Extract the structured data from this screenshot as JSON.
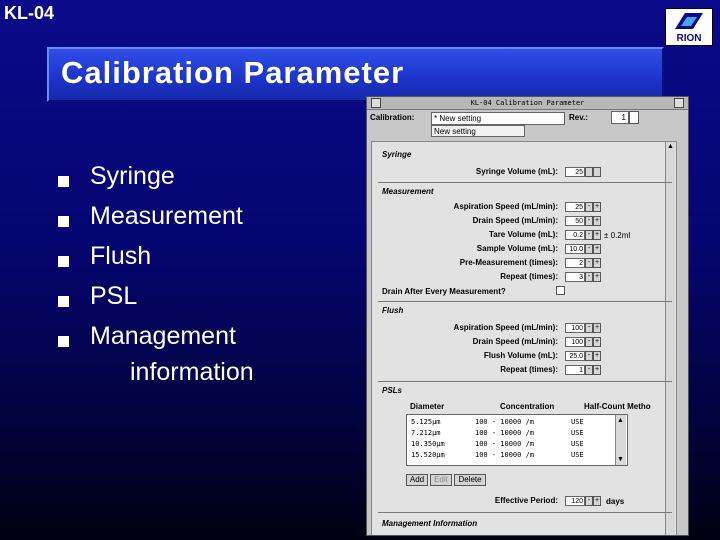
{
  "slide": {
    "id": "KL-04",
    "logo_text": "RION",
    "title": "Calibration Parameter",
    "bullets": [
      "Syringe",
      "Measurement",
      "Flush",
      "PSL",
      "Management"
    ],
    "bullet_continuation": "information"
  },
  "dialog": {
    "title": "KL-04 Calibration Parameter",
    "calibration_label": "Calibration:",
    "calibration_value": "* New setting",
    "calibration_option": "New setting",
    "rev_label": "Rev.:",
    "rev_value": "1",
    "syringe": {
      "title": "Syringe",
      "rows": [
        {
          "label": "Syringe Volume (mL):",
          "value": "25"
        }
      ]
    },
    "measurement": {
      "title": "Measurement",
      "rows": [
        {
          "label": "Aspiration Speed (mL/min):",
          "value": "25"
        },
        {
          "label": "Drain Speed (mL/min):",
          "value": "50"
        },
        {
          "label": "Tare Volume (mL):",
          "value": "0.2"
        },
        {
          "label": "Sample Volume (mL):",
          "value": "10.0"
        },
        {
          "label": "Pre-Measurement (times):",
          "value": "2"
        },
        {
          "label": "Repeat (times):",
          "value": "3"
        }
      ],
      "tare_unit": "± 0.2ml",
      "drain_after_label": "Drain After Every Measurement?"
    },
    "flush": {
      "title": "Flush",
      "rows": [
        {
          "label": "Aspiration Speed (mL/min):",
          "value": "100"
        },
        {
          "label": "Drain Speed (mL/min):",
          "value": "100"
        },
        {
          "label": "Flush Volume (mL):",
          "value": "25.0"
        },
        {
          "label": "Repeat (times):",
          "value": "1"
        }
      ]
    },
    "psls": {
      "title": "PSLs",
      "columns": [
        "Diameter",
        "Concentration",
        "Half-Count Metho"
      ],
      "rows": [
        {
          "diameter": "5.125µm",
          "concentration": "100 - 10000 /m",
          "half": "USE"
        },
        {
          "diameter": "7.212µm",
          "concentration": "100 - 10000 /m",
          "half": "USE"
        },
        {
          "diameter": "10.350µm",
          "concentration": "100 - 10000 /m",
          "half": "USE"
        },
        {
          "diameter": "15.520µm",
          "concentration": "100 - 10000 /m",
          "half": "USE"
        }
      ],
      "buttons": {
        "add": "Add",
        "edit": "Edit",
        "delete": "Delete"
      },
      "effective_label": "Effective Period:",
      "effective_value": "120",
      "effective_unit": "days"
    },
    "management": {
      "title": "Management Information"
    }
  },
  "colors": {
    "background": "#050570",
    "title_bar": "#1c33c9",
    "dialog": "#c8c8c8"
  }
}
